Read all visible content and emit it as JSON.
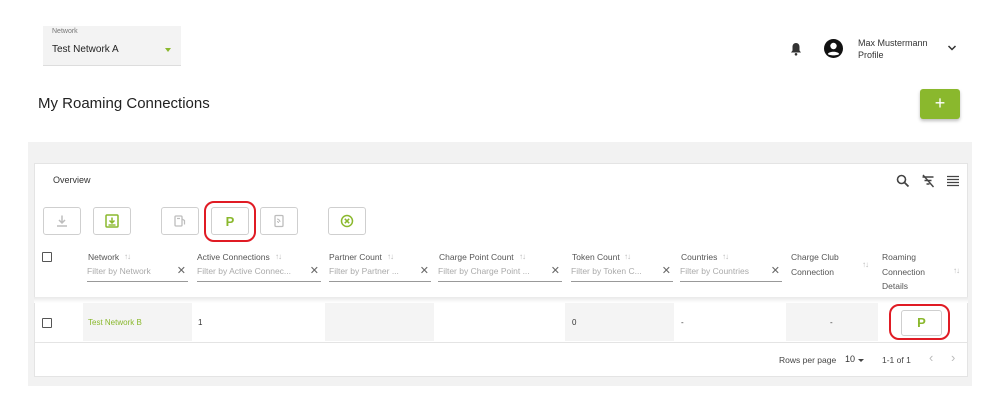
{
  "network_selector": {
    "label": "Network",
    "value": "Test Network A"
  },
  "header": {
    "user_name": "Max Mustermann",
    "user_subtitle": "Profile"
  },
  "page": {
    "title": "My Roaming Connections",
    "add_label": "+"
  },
  "card": {
    "title": "Overview",
    "toolbar_icons": [
      "search-icon",
      "filter-off-icon",
      "columns-menu-icon"
    ],
    "action_buttons": [
      {
        "name": "download-icon",
        "enabled": false
      },
      {
        "name": "import-icon",
        "enabled": true
      },
      {
        "name": "charge-point-icon",
        "enabled": false
      },
      {
        "name": "parking-icon",
        "label": "P",
        "enabled": true,
        "highlighted": true
      },
      {
        "name": "token-card-icon",
        "enabled": false
      },
      {
        "name": "remove-circle-icon",
        "enabled": true
      }
    ]
  },
  "table": {
    "columns": [
      {
        "label": "Network",
        "filter_placeholder": "Filter by Network"
      },
      {
        "label": "Active Connections",
        "filter_placeholder": "Filter by Active Connec..."
      },
      {
        "label": "Partner Count",
        "filter_placeholder": "Filter by Partner ..."
      },
      {
        "label": "Charge Point Count",
        "filter_placeholder": "Filter by Charge Point ..."
      },
      {
        "label": "Token Count",
        "filter_placeholder": "Filter by Token C..."
      },
      {
        "label": "Countries",
        "filter_placeholder": "Filter by Countries"
      },
      {
        "label_line1": "Charge Club",
        "label_line2": "Connection"
      },
      {
        "label_line1": "Roaming",
        "label_line2": "Connection",
        "label_line3": "Details"
      }
    ],
    "sort_glyph": "↑↓",
    "clear_glyph": "✕",
    "rows": [
      {
        "network": "Test Network B",
        "active_connections": "1",
        "partner_count": "",
        "charge_point_count": "",
        "token_count": "0",
        "countries": "-",
        "charge_club_connection": "-",
        "details_label": "P"
      }
    ]
  },
  "pagination": {
    "rows_per_page_label": "Rows per page",
    "rows_per_page_value": "10",
    "range_text": "1-1 of 1",
    "prev_glyph": "‹",
    "next_glyph": "›"
  },
  "colors": {
    "accent": "#8ab82d",
    "highlight": "#e01b24"
  }
}
